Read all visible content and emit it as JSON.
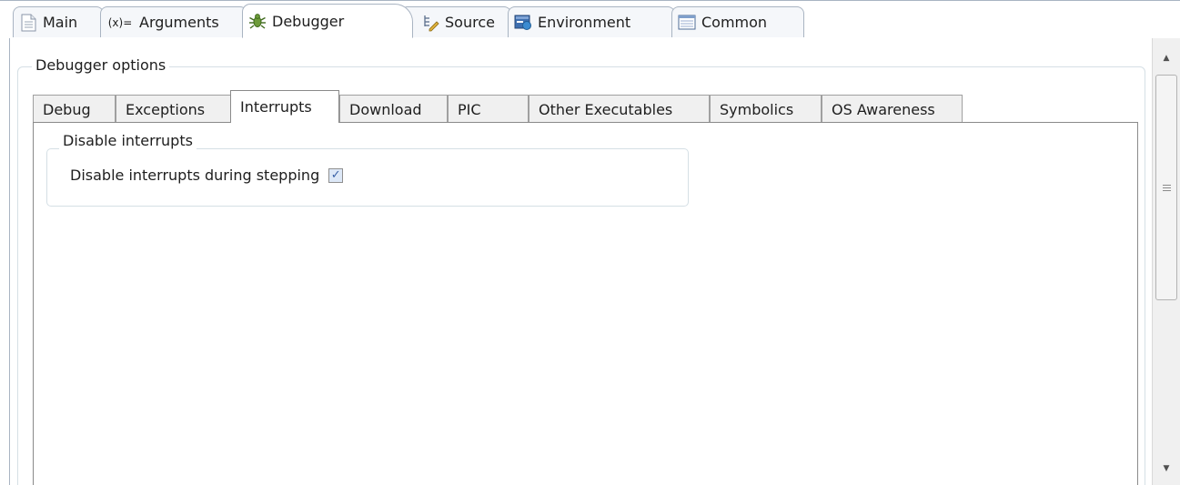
{
  "top_tabs": [
    {
      "label": "Main",
      "icon": "document-icon"
    },
    {
      "label": "Arguments",
      "icon": "variables-icon",
      "icon_text": "(x)="
    },
    {
      "label": "Debugger",
      "icon": "bug-icon",
      "active": true
    },
    {
      "label": "Source",
      "icon": "source-lookup-icon"
    },
    {
      "label": "Environment",
      "icon": "environment-icon"
    },
    {
      "label": "Common",
      "icon": "common-icon"
    }
  ],
  "debugger_options": {
    "legend": "Debugger options",
    "tabs": [
      "Debug",
      "Exceptions",
      "Interrupts",
      "Download",
      "PIC",
      "Other Executables",
      "Symbolics",
      "OS Awareness"
    ],
    "active_tab": "Interrupts"
  },
  "interrupts": {
    "group_legend": "Disable interrupts",
    "checkbox_label": "Disable interrupts during stepping",
    "checkbox_checked": true,
    "check_glyph": "✓"
  },
  "scrollbar": {
    "up_glyph": "▲",
    "down_glyph": "▼"
  },
  "colors": {
    "border": "#a9b4c2",
    "active_tab_bg": "#ffffff",
    "inactive_tab_bg": "#f0f0f0",
    "checkbox_fill": "#dde8f7",
    "check_color": "#3a62a8"
  }
}
